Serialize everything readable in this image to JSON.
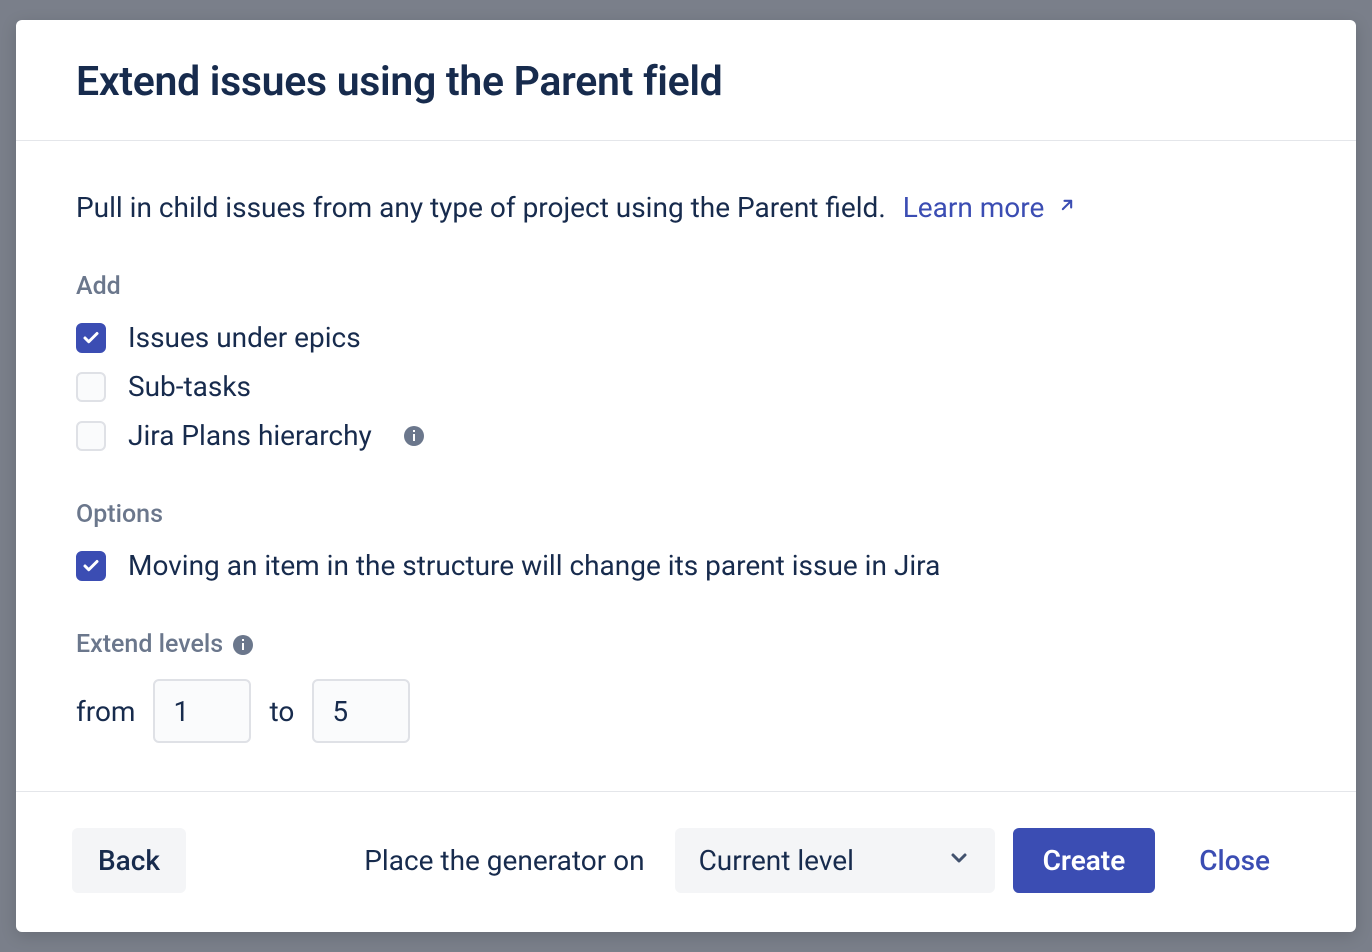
{
  "dialog": {
    "title": "Extend issues using the Parent field",
    "description": "Pull in child issues from any type of project using the Parent field.",
    "learn_more": "Learn more"
  },
  "add": {
    "label": "Add",
    "items": [
      {
        "label": "Issues under epics",
        "checked": true,
        "info": false
      },
      {
        "label": "Sub-tasks",
        "checked": false,
        "info": false
      },
      {
        "label": "Jira Plans hierarchy",
        "checked": false,
        "info": true
      }
    ]
  },
  "options": {
    "label": "Options",
    "items": [
      {
        "label": "Moving an item in the structure will change its parent issue in Jira",
        "checked": true
      }
    ]
  },
  "levels": {
    "label": "Extend levels",
    "from_label": "from",
    "from_value": "1",
    "to_label": "to",
    "to_value": "5"
  },
  "footer": {
    "back": "Back",
    "place_label": "Place the generator on",
    "select_value": "Current level",
    "create": "Create",
    "close": "Close"
  }
}
